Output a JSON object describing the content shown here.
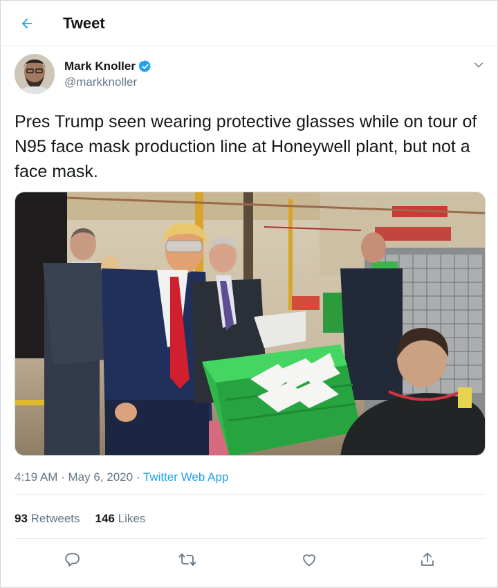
{
  "header": {
    "title": "Tweet",
    "back_icon": "arrow-left-icon"
  },
  "author": {
    "name": "Mark Knoller",
    "handle": "@markknoller",
    "verified": true
  },
  "tweet": {
    "text": "Pres Trump seen wearing protective glasses while on tour of N95 face mask production line at Honeywell plant, but not a face mask."
  },
  "meta": {
    "time": "4:19 AM",
    "date": "May 6, 2020",
    "source": "Twitter Web App",
    "sep": "·"
  },
  "stats": {
    "retweets_count": "93",
    "retweets_label": "Retweets",
    "likes_count": "146",
    "likes_label": "Likes"
  },
  "actions": [
    "reply-icon",
    "retweet-icon",
    "like-icon",
    "share-icon"
  ],
  "colors": {
    "accent": "#1da1f2",
    "text": "#14171a",
    "muted": "#657786",
    "border": "#e6ecf0"
  }
}
